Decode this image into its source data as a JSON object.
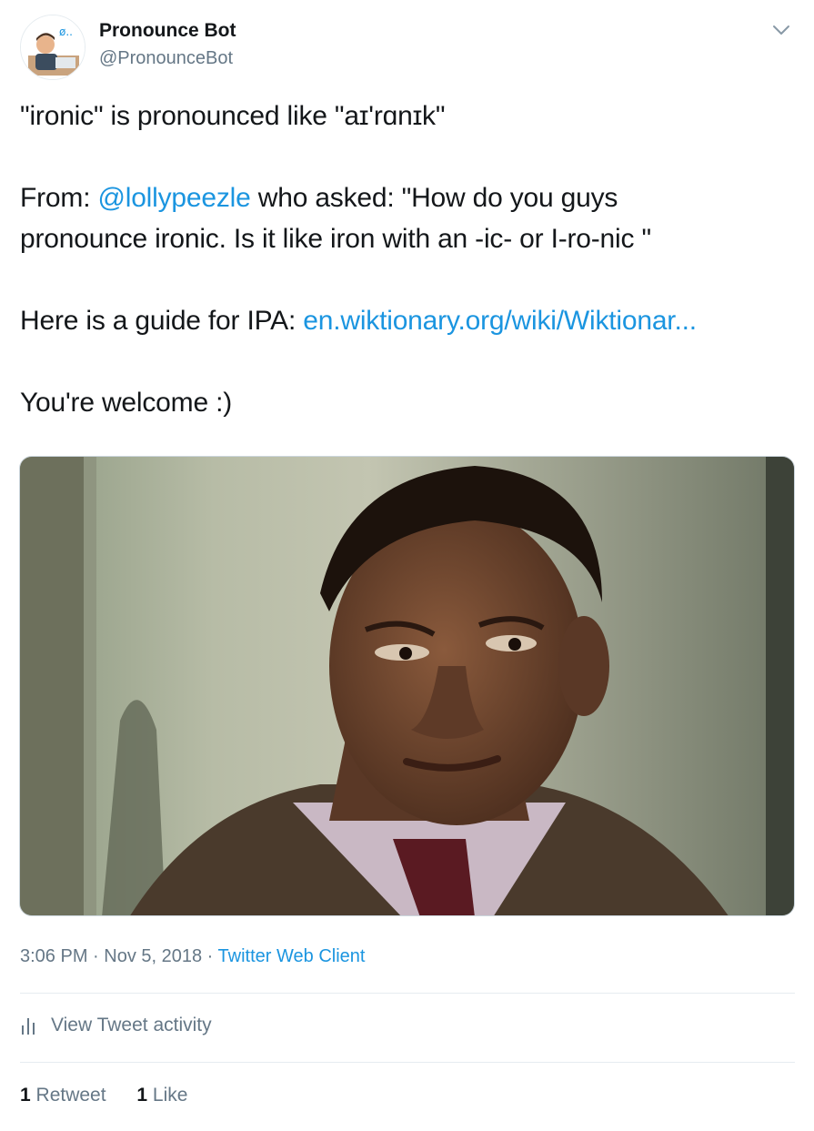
{
  "author": {
    "display_name": "Pronounce Bot",
    "handle": "@PronounceBot"
  },
  "tweet": {
    "line1": "\"ironic\" is pronounced like \"aɪ'rɑnɪk\"",
    "from_label": "From: ",
    "mention": "@lollypeezle",
    "asked_text": " who asked: \"How do you guys",
    "asked_text_2": "pronounce ironic. Is it like iron with an -ic- or I-ro-nic \"",
    "guide_label": "Here is a guide for IPA: ",
    "guide_link": "en.wiktionary.org/wiki/Wiktionar...",
    "closing": "You're welcome :)"
  },
  "media": {
    "description_icon": "photo-meme-man-looking-down"
  },
  "meta": {
    "time": "3:06 PM",
    "sep1": " · ",
    "date": "Nov 5, 2018",
    "sep2": " · ",
    "client": "Twitter Web Client"
  },
  "activity": {
    "label": "View Tweet activity",
    "icon": "bar-chart-icon"
  },
  "stats": {
    "retweet_count": "1",
    "retweet_label": " Retweet",
    "like_count": "1",
    "like_label": " Like"
  },
  "colors": {
    "link": "#1b95e0",
    "secondary_text": "#657786",
    "primary_text": "#14171a",
    "divider": "#e6ecf0"
  }
}
